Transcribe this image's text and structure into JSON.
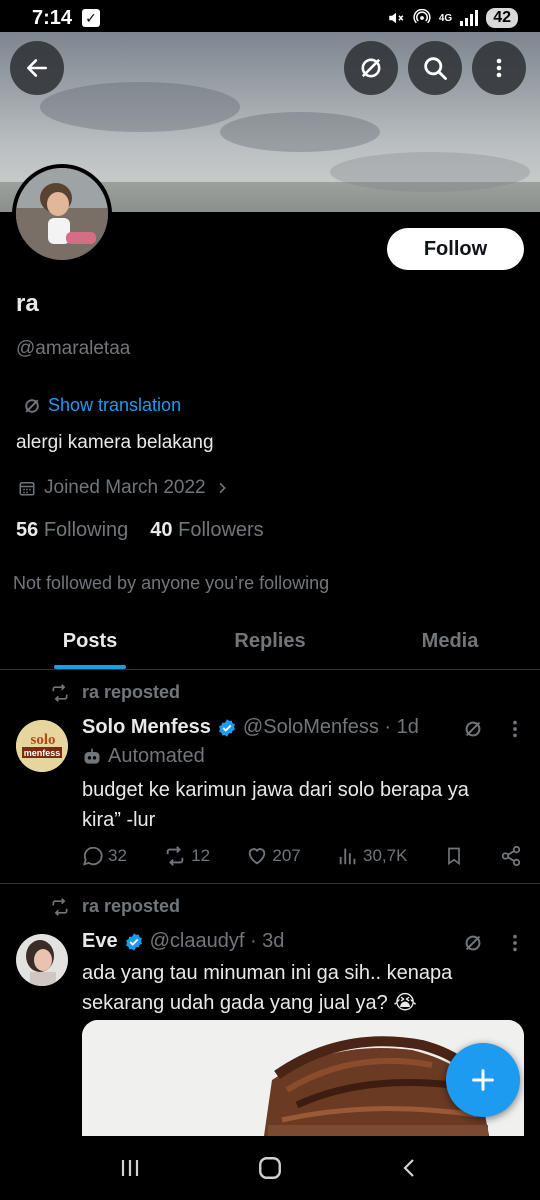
{
  "status": {
    "time": "7:14",
    "network": "4G",
    "battery": "42"
  },
  "profile": {
    "name": "ra",
    "handle": "@amaraletaa",
    "translate_label": "Show translation",
    "bio": "alergi kamera belakang",
    "joined": "Joined March 2022",
    "following_count": "56",
    "following_label": "Following",
    "followers_count": "40",
    "followers_label": "Followers",
    "not_followed": "Not followed by anyone you’re following",
    "follow_button": "Follow"
  },
  "tabs": [
    {
      "label": "Posts",
      "active": true
    },
    {
      "label": "Replies",
      "active": false
    },
    {
      "label": "Media",
      "active": false
    }
  ],
  "posts": [
    {
      "repost_label": "ra reposted",
      "author": "Solo Menfess",
      "handle_time": "@SoloMenfess · 1d",
      "automated_label": "Automated",
      "text": "budget ke karimun jawa dari solo berapa ya kira” -lur",
      "avatar_text_1": "solo",
      "avatar_text_2": "menfess",
      "replies": "32",
      "reposts": "12",
      "likes": "207",
      "views": "30,7K"
    },
    {
      "repost_label": "ra reposted",
      "author": "Eve",
      "handle_time": "@claaudyf · 3d",
      "text": "ada yang tau minuman ini ga sih.. kenapa sekarang udah gada yang jual ya? 😭"
    }
  ],
  "colors": {
    "accent": "#1d9bf0",
    "muted": "#71767b",
    "text": "#e7e9ea",
    "background": "#000000"
  }
}
